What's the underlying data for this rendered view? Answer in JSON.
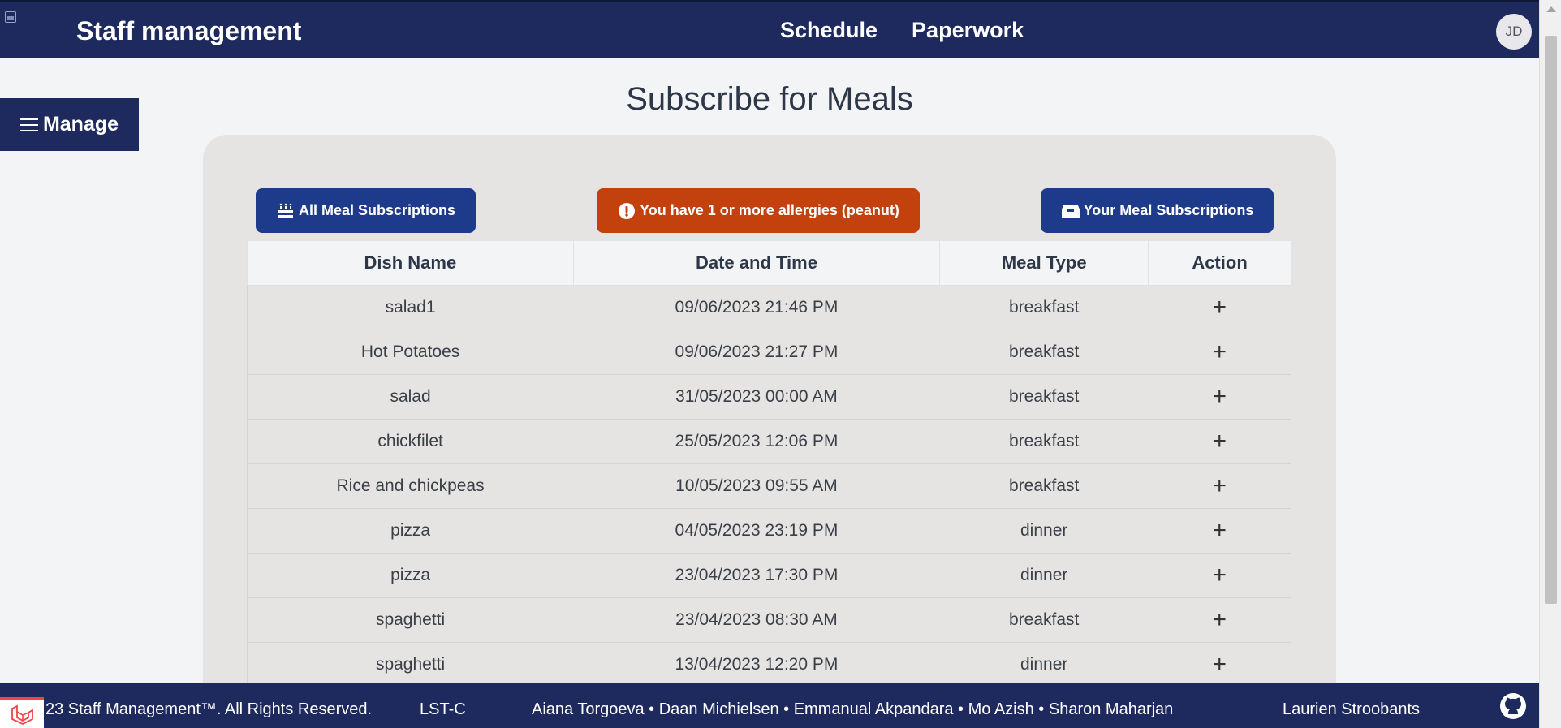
{
  "header": {
    "app_title": "Staff management",
    "nav": [
      "Schedule",
      "Paperwork"
    ],
    "avatar_initials": "JD"
  },
  "sidebar": {
    "manage_label": "Manage"
  },
  "page": {
    "title": "Subscribe for Meals"
  },
  "toolbar": {
    "all_label": "All Meal Subscriptions",
    "allergy_label": "You have 1 or more allergies (peanut)",
    "yours_label": "Your Meal Subscriptions"
  },
  "table": {
    "headers": [
      "Dish Name",
      "Date and Time",
      "Meal Type",
      "Action"
    ],
    "rows": [
      [
        "salad1",
        "09/06/2023 21:46 PM",
        "breakfast"
      ],
      [
        "Hot Potatoes",
        "09/06/2023 21:27 PM",
        "breakfast"
      ],
      [
        "salad",
        "31/05/2023 00:00 AM",
        "breakfast"
      ],
      [
        "chickfilet",
        "25/05/2023 12:06 PM",
        "breakfast"
      ],
      [
        "Rice and chickpeas",
        "10/05/2023 09:55 AM",
        "breakfast"
      ],
      [
        "pizza",
        "04/05/2023 23:19 PM",
        "dinner"
      ],
      [
        "pizza",
        "23/04/2023 17:30 PM",
        "dinner"
      ],
      [
        "spaghetti",
        "23/04/2023 08:30 AM",
        "breakfast"
      ],
      [
        "spaghetti",
        "13/04/2023 12:20 PM",
        "dinner"
      ]
    ],
    "action_symbol": "+"
  },
  "footer": {
    "copyright": "23 Staff Management™. All Rights Reserved.",
    "code": "LST-C",
    "authors": "Aiana Torgoeva • Daan Michielsen • Emmanual Akpandara • Mo Azish • Sharon Maharjan",
    "extra_author": "Laurien Stroobants"
  },
  "colors": {
    "navy": "#1e2a5e",
    "button_blue": "#1e3a8a",
    "allergy_orange": "#c2410c",
    "card_bg": "#e5e4e2"
  },
  "icons": {
    "all": "cake-icon",
    "allergy": "exclamation-circle-icon",
    "yours": "inbox-icon",
    "menu": "hamburger-icon",
    "footer": "github-icon"
  }
}
